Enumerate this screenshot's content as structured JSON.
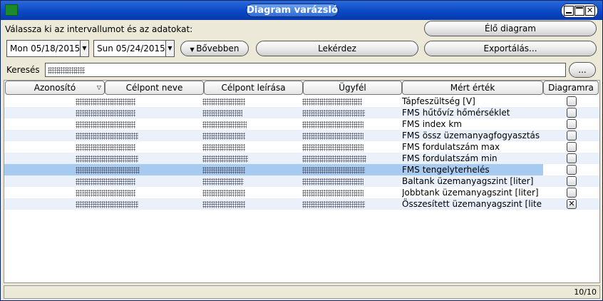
{
  "window": {
    "title": "Diagram varázsló"
  },
  "toolbar": {
    "prompt": "Válassza ki az intervallumot és az adatokat:",
    "live_chart_label": "Élő diagram",
    "date_from": "Mon 05/18/2015",
    "date_to": "Sun 05/24/2015",
    "more_label": "Bővebben",
    "query_label": "Lekérdez",
    "export_label": "Exportálás...",
    "search_label": "Keresés",
    "browse_label": "..."
  },
  "table": {
    "columns": [
      "Azonosító",
      "Célpont neve",
      "Célpont leírása",
      "Ügyfél",
      "Mért érték",
      "Diagramra"
    ],
    "rows": [
      {
        "measure": "Tápfeszültség [V]",
        "checked": ""
      },
      {
        "measure": "FMS hűtővíz hőmérséklet",
        "checked": ""
      },
      {
        "measure": "FMS index km",
        "checked": ""
      },
      {
        "measure": "FMS össz üzemanyagfogyasztás",
        "checked": ""
      },
      {
        "measure": "FMS fordulatszám max",
        "checked": ""
      },
      {
        "measure": "FMS fordulatszám min",
        "checked": ""
      },
      {
        "measure": "FMS tengelyterhelés",
        "checked": ""
      },
      {
        "measure": "Baltank üzemanyagszint [liter]",
        "checked": ""
      },
      {
        "measure": "Jobbtank üzemanyagszint [liter]",
        "checked": ""
      },
      {
        "measure": "Összesített üzemanyagszint [liter]",
        "checked": "✕"
      }
    ],
    "selected_row": 6
  },
  "status": {
    "count": "10/10"
  }
}
